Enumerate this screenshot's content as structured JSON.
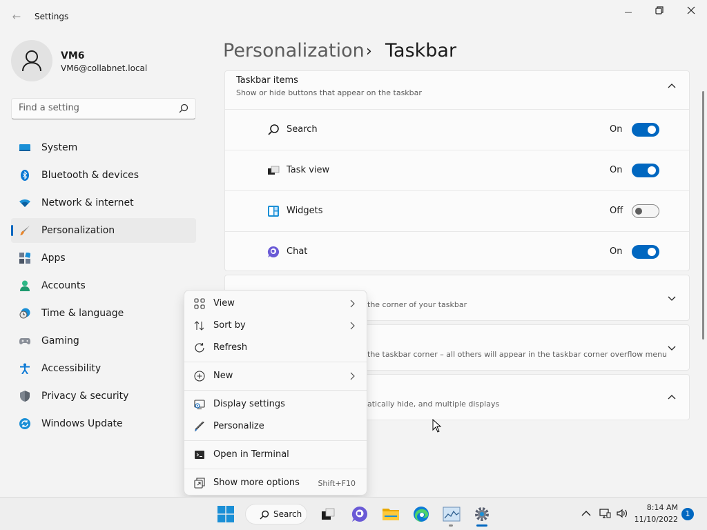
{
  "window": {
    "title": "Settings",
    "back_glyph": "←",
    "minimize_glyph": "—",
    "maximize_glyph": "▢",
    "close_glyph": "✕"
  },
  "profile": {
    "name": "VM6",
    "email": "VM6@collabnet.local"
  },
  "search": {
    "placeholder": "Find a setting"
  },
  "sidebar": {
    "items": [
      {
        "label": "System",
        "icon": "monitor-icon"
      },
      {
        "label": "Bluetooth & devices",
        "icon": "bluetooth-icon"
      },
      {
        "label": "Network & internet",
        "icon": "wifi-icon"
      },
      {
        "label": "Personalization",
        "icon": "brush-icon",
        "active": true
      },
      {
        "label": "Apps",
        "icon": "apps-icon"
      },
      {
        "label": "Accounts",
        "icon": "accounts-icon"
      },
      {
        "label": "Time & language",
        "icon": "clock-globe-icon"
      },
      {
        "label": "Gaming",
        "icon": "controller-icon"
      },
      {
        "label": "Accessibility",
        "icon": "accessibility-icon"
      },
      {
        "label": "Privacy & security",
        "icon": "shield-icon"
      },
      {
        "label": "Windows Update",
        "icon": "update-icon"
      }
    ]
  },
  "breadcrumb": {
    "parent": "Personalization",
    "separator": "›",
    "current": "Taskbar"
  },
  "taskbar_items": {
    "title": "Taskbar items",
    "subtitle": "Show or hide buttons that appear on the taskbar",
    "rows": [
      {
        "label": "Search",
        "state": "On",
        "on": true,
        "icon": "search-icon"
      },
      {
        "label": "Task view",
        "state": "On",
        "on": true,
        "icon": "task-view-icon"
      },
      {
        "label": "Widgets",
        "state": "Off",
        "on": false,
        "icon": "widgets-icon"
      },
      {
        "label": "Chat",
        "state": "On",
        "on": true,
        "icon": "chat-icon"
      }
    ]
  },
  "collapsed_sections": [
    {
      "desc": "the corner of your taskbar"
    },
    {
      "desc": "the taskbar corner – all others will appear in the taskbar corner overflow menu"
    },
    {
      "desc": "atically hide, and multiple displays"
    }
  ],
  "context_menu": {
    "items": [
      {
        "label": "View",
        "icon": "view-grid-icon",
        "submenu": true
      },
      {
        "label": "Sort by",
        "icon": "sort-icon",
        "submenu": true
      },
      {
        "label": "Refresh",
        "icon": "refresh-icon"
      },
      {
        "label": "New",
        "icon": "plus-circle-icon",
        "submenu": true
      },
      {
        "label": "Display settings",
        "icon": "display-settings-icon"
      },
      {
        "label": "Personalize",
        "icon": "pen-icon"
      },
      {
        "label": "Open in Terminal",
        "icon": "terminal-icon"
      },
      {
        "label": "Show more options",
        "icon": "more-options-icon",
        "shortcut": "Shift+F10"
      }
    ]
  },
  "taskbar": {
    "search_label": "Search",
    "time": "8:14 AM",
    "date": "11/10/2022",
    "notification_count": "1"
  },
  "colors": {
    "accent": "#0067c0",
    "background": "#f3f3f3",
    "card": "#fbfbfb"
  }
}
